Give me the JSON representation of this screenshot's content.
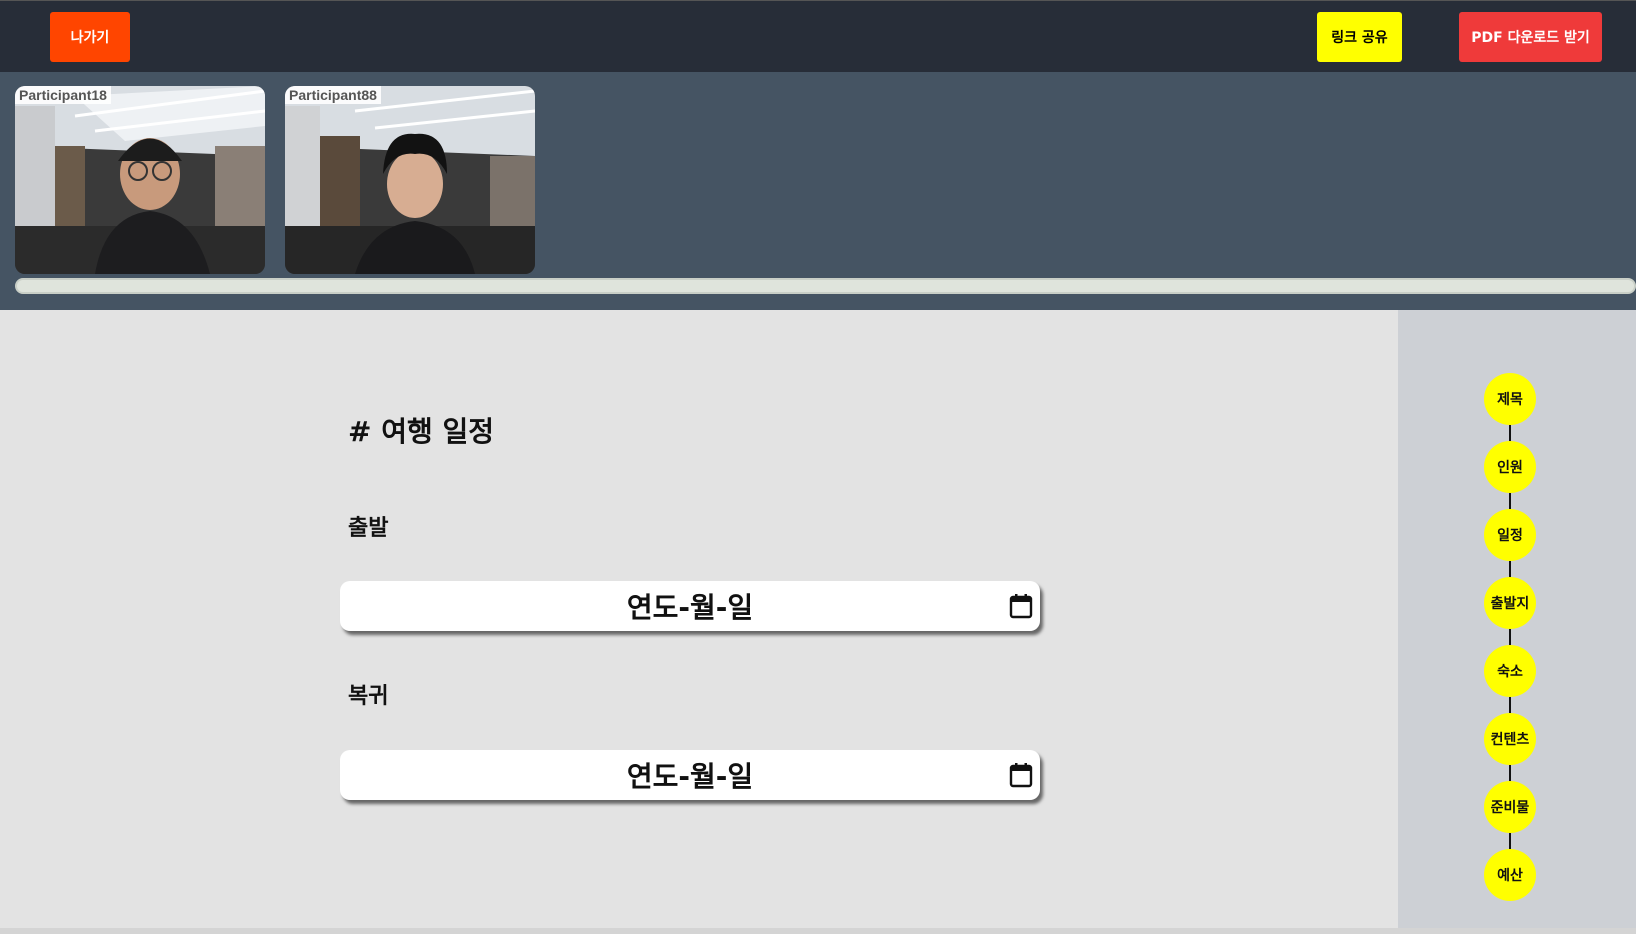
{
  "topbar": {
    "exit_label": "나가기",
    "share_label": "링크 공유",
    "pdf_label": "PDF 다운로드 받기",
    "colors": {
      "exit": "#ff4500",
      "share": "#ffff00",
      "pdf": "#ef3a3a",
      "bar": "#272d38"
    }
  },
  "participants": [
    {
      "name": "Participant18"
    },
    {
      "name": "Participant88"
    }
  ],
  "main": {
    "heading": "# 여행 일정",
    "depart_label": "출발",
    "return_label": "복귀",
    "depart_value": "연도-월-일",
    "return_value": "연도-월-일"
  },
  "sidenav": {
    "items": [
      "제목",
      "인원",
      "일정",
      "출발지",
      "숙소",
      "컨텐츠",
      "준비물",
      "예산"
    ],
    "color": "#ffff00"
  }
}
